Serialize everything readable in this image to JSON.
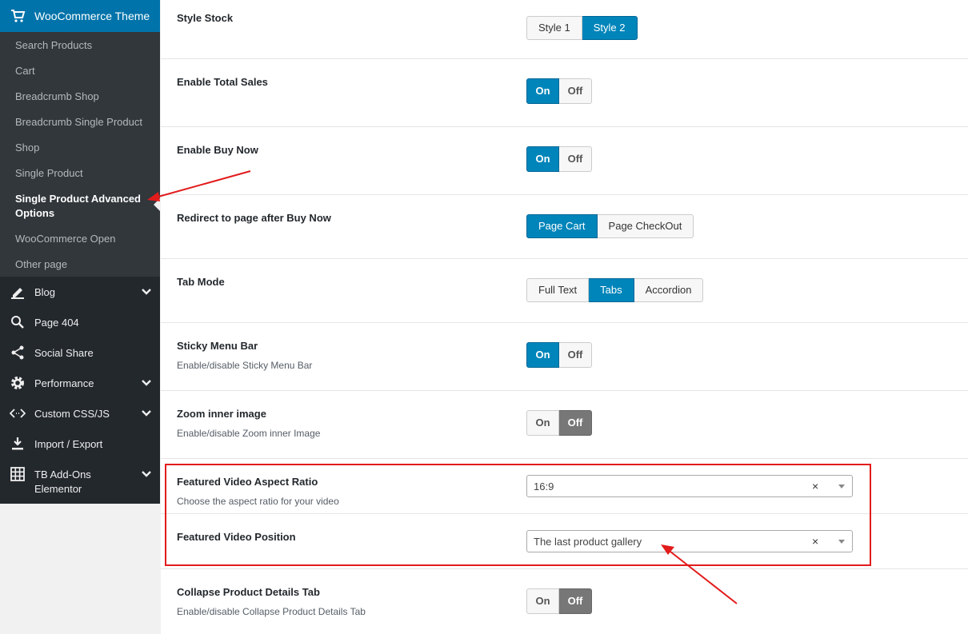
{
  "sidebar": {
    "header": {
      "label": "WooCommerce Theme",
      "icon": "cart-icon"
    },
    "sub_items": [
      {
        "label": "Search Products"
      },
      {
        "label": "Cart"
      },
      {
        "label": "Breadcrumb Shop"
      },
      {
        "label": "Breadcrumb Single Product"
      },
      {
        "label": "Shop"
      },
      {
        "label": "Single Product"
      },
      {
        "label": "Single Product Advanced Options",
        "active": true
      },
      {
        "label": "WooCommerce Open"
      },
      {
        "label": "Other page"
      }
    ],
    "menu": [
      {
        "label": "Blog",
        "icon": "pencil-icon",
        "has_children": true
      },
      {
        "label": "Page 404",
        "icon": "search-page-icon",
        "has_children": false
      },
      {
        "label": "Social Share",
        "icon": "share-icon",
        "has_children": false
      },
      {
        "label": "Performance",
        "icon": "gear-icon",
        "has_children": true
      },
      {
        "label": "Custom CSS/JS",
        "icon": "code-icon",
        "has_children": true
      },
      {
        "label": "Import / Export",
        "icon": "download-icon",
        "has_children": false
      },
      {
        "label": "TB Add-Ons Elementor",
        "icon": "grid-icon",
        "has_children": true
      }
    ]
  },
  "settings": {
    "style_stock": {
      "title": "Style Stock",
      "options": [
        "Style 1",
        "Style 2"
      ],
      "selected": "Style 2"
    },
    "total_sales": {
      "title": "Enable Total Sales",
      "on": "On",
      "off": "Off",
      "value": "On"
    },
    "buy_now": {
      "title": "Enable Buy Now",
      "on": "On",
      "off": "Off",
      "value": "On"
    },
    "redirect": {
      "title": "Redirect to page after Buy Now",
      "options": [
        "Page Cart",
        "Page CheckOut"
      ],
      "selected": "Page Cart"
    },
    "tab_mode": {
      "title": "Tab Mode",
      "options": [
        "Full Text",
        "Tabs",
        "Accordion"
      ],
      "selected": "Tabs"
    },
    "sticky_menu": {
      "title": "Sticky Menu Bar",
      "desc": "Enable/disable Sticky Menu Bar",
      "on": "On",
      "off": "Off",
      "value": "On"
    },
    "zoom": {
      "title": "Zoom inner image",
      "desc": "Enable/disable Zoom inner Image",
      "on": "On",
      "off": "Off",
      "value": "Off"
    },
    "video_ratio": {
      "title": "Featured Video Aspect Ratio",
      "desc": "Choose the aspect ratio for your video",
      "value": "16:9",
      "clear": "×"
    },
    "video_position": {
      "title": "Featured Video Position",
      "value": "The last product gallery",
      "clear": "×"
    },
    "collapse_tab": {
      "title": "Collapse Product Details Tab",
      "desc": "Enable/disable Collapse Product Details Tab",
      "on": "On",
      "off": "Off",
      "value": "Off"
    }
  },
  "colors": {
    "accent": "#0085ba",
    "sidebar": "#23282d",
    "annotation": "#e21b1b"
  }
}
